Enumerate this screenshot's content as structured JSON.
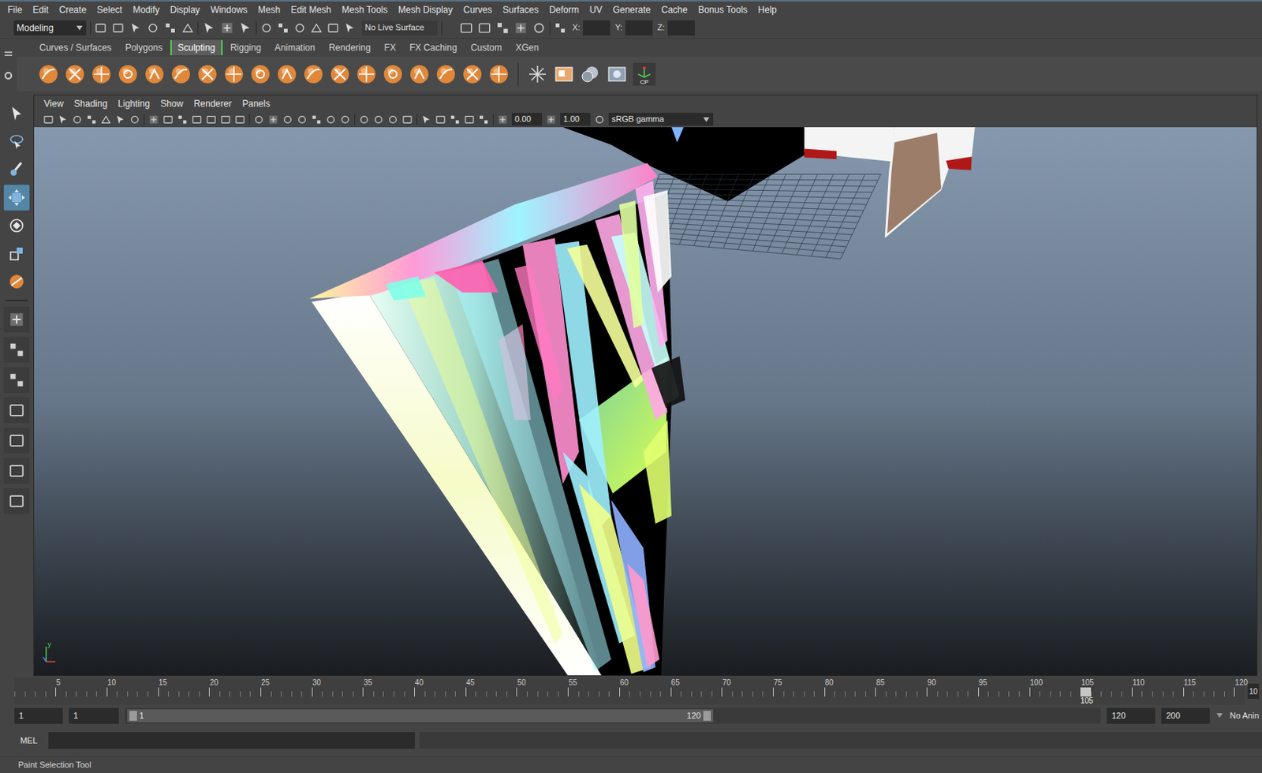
{
  "window": {
    "title": "Maya"
  },
  "menu_bar": [
    "File",
    "Edit",
    "Create",
    "Select",
    "Modify",
    "Display",
    "Windows",
    "Mesh",
    "Edit Mesh",
    "Mesh Tools",
    "Mesh Display",
    "Curves",
    "Surfaces",
    "Deform",
    "UV",
    "Generate",
    "Cache",
    "Bonus Tools",
    "Help"
  ],
  "status_line": {
    "mode": "Modeling",
    "live_surface": "No Live Surface",
    "coords": [
      "X:",
      "Y:",
      "Z:"
    ]
  },
  "shelf": {
    "tabs": [
      {
        "label": "Curves / Surfaces",
        "selected": false
      },
      {
        "label": "Polygons",
        "selected": false
      },
      {
        "label": "Sculpting",
        "selected": true
      },
      {
        "label": "Rigging",
        "selected": false
      },
      {
        "label": "Animation",
        "selected": false
      },
      {
        "label": "Rendering",
        "selected": false
      },
      {
        "label": "FX",
        "selected": false
      },
      {
        "label": "FX Caching",
        "selected": false
      },
      {
        "label": "Custom",
        "selected": false
      },
      {
        "label": "XGen",
        "selected": false
      }
    ],
    "badge": "CP"
  },
  "toolbox": {
    "tools": [
      {
        "kind": "select",
        "selected": false
      },
      {
        "kind": "lasso",
        "selected": false
      },
      {
        "kind": "paint",
        "selected": false
      },
      {
        "kind": "move",
        "selected": true
      },
      {
        "kind": "rotate",
        "selected": false
      },
      {
        "kind": "scale",
        "selected": false
      },
      {
        "kind": "last",
        "selected": false
      }
    ]
  },
  "panel_menu": [
    "View",
    "Shading",
    "Lighting",
    "Show",
    "Renderer",
    "Panels"
  ],
  "viewport_toolbar": {
    "exposure": "0.00",
    "gamma": "1.00",
    "color_space": "sRGB gamma"
  },
  "viewport": {
    "axis_label": "y"
  },
  "time_slider": {
    "ticks": [
      "5",
      "10",
      "15",
      "20",
      "25",
      "30",
      "35",
      "40",
      "45",
      "50",
      "55",
      "60",
      "65",
      "70",
      "75",
      "80",
      "85",
      "90",
      "95",
      "100",
      "105",
      "110",
      "115",
      "120"
    ],
    "current": "105",
    "current_field": "10"
  },
  "range_slider": {
    "start": "1",
    "playback_start": "1",
    "slider_start": "1",
    "slider_end": "120",
    "playback_end": "120",
    "end": "200",
    "anim_layer": "No Anin"
  },
  "command_line": {
    "language": "MEL"
  },
  "help_line": "Paint Selection Tool"
}
